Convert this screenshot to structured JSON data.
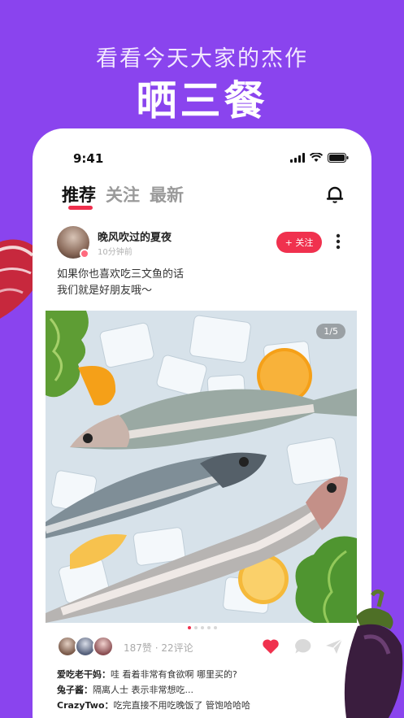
{
  "promo": {
    "subtitle": "看看今天大家的杰作",
    "title": "晒三餐"
  },
  "status_bar": {
    "time": "9:41"
  },
  "tabs": [
    {
      "label": "推荐",
      "active": true
    },
    {
      "label": "关注",
      "active": false
    },
    {
      "label": "最新",
      "active": false
    }
  ],
  "post": {
    "username": "晚风吹过的夏夜",
    "time_ago": "10分钟前",
    "follow_label": "+ 关注",
    "caption_line1": "如果你也喜欢吃三文鱼的话",
    "caption_line2": "我们就是好朋友哦～",
    "image_counter": "1/5",
    "image_count": 5,
    "current_image": 1,
    "stats": "187赞 · 22评论",
    "liked": true
  },
  "comments": [
    {
      "author": "爱吃老干妈：",
      "text": "哇 看着非常有食欲啊 哪里买的?"
    },
    {
      "author": "兔子酱：",
      "text": "隔离人士 表示非常想吃..."
    },
    {
      "author": "CrazyTwo：",
      "text": "吃完直接不用吃晚饭了 管饱哈哈哈"
    }
  ],
  "colors": {
    "background": "#8a44ee",
    "accent": "#f0314e"
  }
}
